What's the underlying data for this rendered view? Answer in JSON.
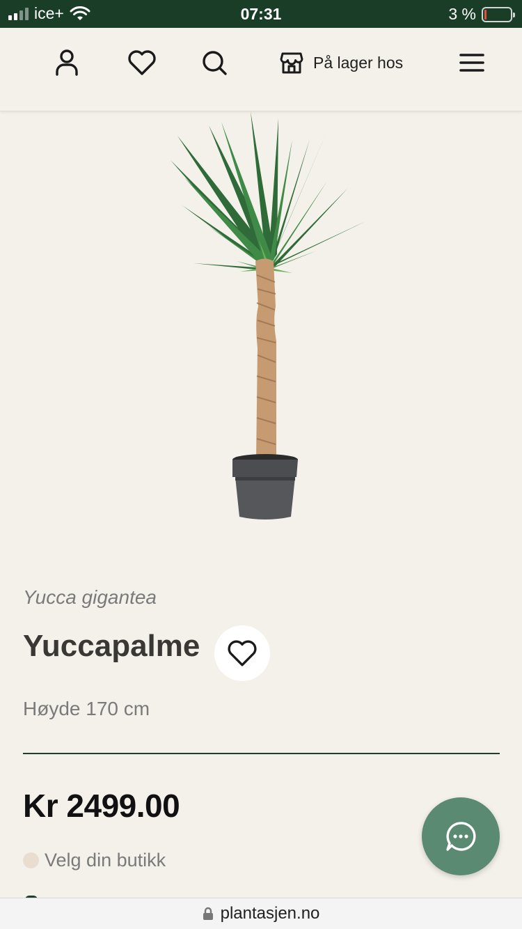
{
  "status_bar": {
    "carrier": "ice+",
    "time": "07:31",
    "battery_percent": "3 %",
    "battery_level": 0.03,
    "signal_bars": 2
  },
  "header": {
    "icons": [
      "user-icon",
      "heart-icon",
      "search-icon",
      "store-icon",
      "menu-icon"
    ],
    "store_label": "På lager hos"
  },
  "product": {
    "latin_name": "Yucca gigantea",
    "name": "Yuccapalme",
    "height": "Høyde 170 cm",
    "price": "Kr 2499.00",
    "store_select_label": "Velg din butikk"
  },
  "chat": {
    "icon": "chat-bubble-icon"
  },
  "url_bar": {
    "domain": "plantasjen.no",
    "icon": "lock-icon"
  },
  "colors": {
    "status_bar_bg": "#1a3d28",
    "page_bg": "#f4f1ea",
    "accent_green": "#1f3d2a",
    "chat_button": "#5a8a72",
    "battery_low": "#e74c3c"
  }
}
